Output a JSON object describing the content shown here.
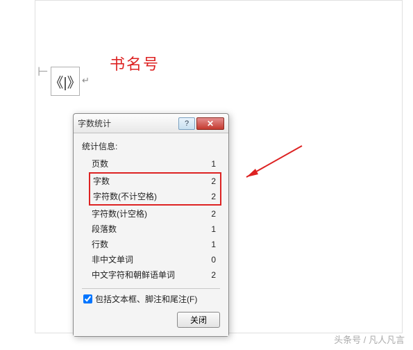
{
  "document": {
    "bracket_symbol": "《|》",
    "title_annotation": "书名号"
  },
  "dialog": {
    "title": "字数统计",
    "help_symbol": "?",
    "close_symbol": "✕",
    "stats_header": "统计信息:",
    "rows": [
      {
        "label": "页数",
        "value": "1"
      },
      {
        "label": "字数",
        "value": "2"
      },
      {
        "label": "字符数(不计空格)",
        "value": "2"
      },
      {
        "label": "字符数(计空格)",
        "value": "2"
      },
      {
        "label": "段落数",
        "value": "1"
      },
      {
        "label": "行数",
        "value": "1"
      },
      {
        "label": "非中文单词",
        "value": "0"
      },
      {
        "label": "中文字符和朝鲜语单词",
        "value": "2"
      }
    ],
    "checkbox_label": "包括文本框、脚注和尾注(F)",
    "checkbox_checked": true,
    "close_button": "关闭"
  },
  "watermark": "头条号 / 凡人凡言",
  "colors": {
    "highlight": "#d22",
    "dialog_bg": "#f4f4f4"
  },
  "chart_data": {
    "type": "table",
    "title": "字数统计",
    "categories": [
      "页数",
      "字数",
      "字符数(不计空格)",
      "字符数(计空格)",
      "段落数",
      "行数",
      "非中文单词",
      "中文字符和朝鲜语单词"
    ],
    "values": [
      1,
      2,
      2,
      2,
      1,
      1,
      0,
      2
    ]
  }
}
